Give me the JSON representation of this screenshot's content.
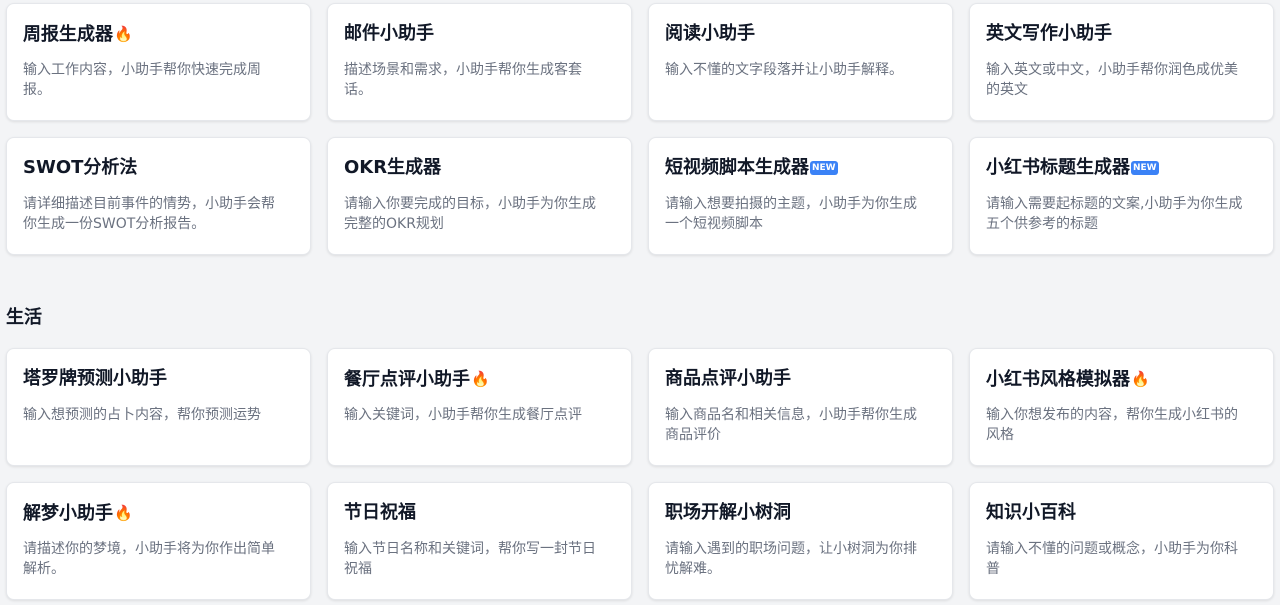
{
  "top_cards": [
    {
      "title": "周报生成器",
      "emoji": "🔥",
      "desc": "输入工作内容，小助手帮你快速完成周报。"
    },
    {
      "title": "邮件小助手",
      "emoji": "",
      "desc": "描述场景和需求，小助手帮你生成客套话。"
    },
    {
      "title": "阅读小助手",
      "emoji": "",
      "desc": "输入不懂的文字段落并让小助手解释。"
    },
    {
      "title": "英文写作小助手",
      "emoji": "",
      "desc": "输入英文或中文，小助手帮你润色成优美的英文"
    },
    {
      "title": "SWOT分析法",
      "emoji": "",
      "desc": "请详细描述目前事件的情势，小助手会帮你生成一份SWOT分析报告。"
    },
    {
      "title": "OKR生成器",
      "emoji": "",
      "desc": "请输入你要完成的目标，小助手为你生成完整的OKR规划"
    },
    {
      "title": "短视频脚本生成器",
      "emoji": "NEW",
      "desc": "请输入想要拍摄的主题，小助手为你生成一个短视频脚本"
    },
    {
      "title": "小红书标题生成器",
      "emoji": "NEW",
      "desc": "请输入需要起标题的文案,小助手为你生成五个供参考的标题"
    }
  ],
  "life_section": {
    "heading": "生活",
    "cards": [
      {
        "title": "塔罗牌预测小助手",
        "emoji": "",
        "desc": "输入想预测的占卜内容，帮你预测运势"
      },
      {
        "title": "餐厅点评小助手",
        "emoji": "🔥",
        "desc": "输入关键词，小助手帮你生成餐厅点评"
      },
      {
        "title": "商品点评小助手",
        "emoji": "",
        "desc": "输入商品名和相关信息，小助手帮你生成商品评价"
      },
      {
        "title": "小红书风格模拟器",
        "emoji": "🔥",
        "desc": "输入你想发布的内容，帮你生成小红书的风格"
      },
      {
        "title": "解梦小助手",
        "emoji": "🔥",
        "desc": "请描述你的梦境，小助手将为你作出简单解析。"
      },
      {
        "title": "节日祝福",
        "emoji": "",
        "desc": "输入节日名称和关键词，帮你写一封节日祝福"
      },
      {
        "title": "职场开解小树洞",
        "emoji": "",
        "desc": "请输入遇到的职场问题，让小树洞为你排忧解难。"
      },
      {
        "title": "知识小百科",
        "emoji": "",
        "desc": "请输入不懂的问题或概念，小助手为你科普"
      }
    ]
  },
  "icons": {
    "fire": "fire-icon",
    "new": "new-badge-icon"
  },
  "colors": {
    "background": "#f3f4f6",
    "card": "#ffffff",
    "title": "#111827",
    "desc": "#6b7280",
    "new_badge": "#3b82f6"
  }
}
